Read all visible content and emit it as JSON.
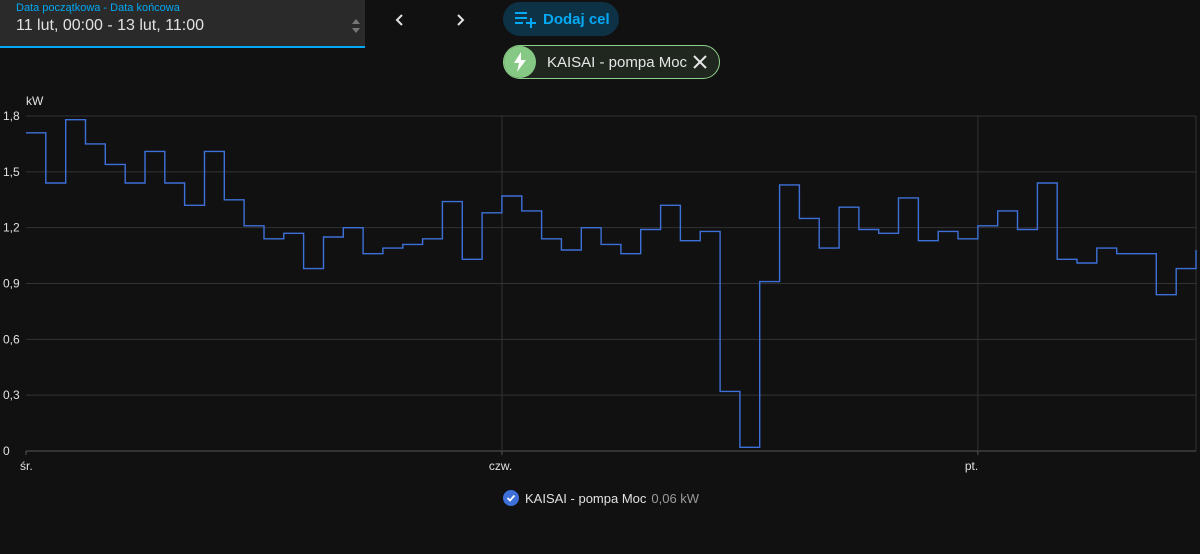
{
  "date_range": {
    "label": "Data początkowa - Data końcowa",
    "value": "11 lut, 00:00 - 13 lut, 11:00"
  },
  "nav": {
    "prev_icon": "chevron-left-icon",
    "next_icon": "chevron-right-icon"
  },
  "add_target": {
    "label": "Dodaj cel",
    "icon": "playlist-plus-icon"
  },
  "entity_chip": {
    "label": "KAISAI - pompa Moc",
    "icon": "flash-icon",
    "close_icon": "close-icon",
    "color": "#86c985"
  },
  "legend": {
    "name": "KAISAI - pompa Moc",
    "value": "0,06 kW",
    "color": "#3d71d9"
  },
  "chart_data": {
    "type": "line",
    "ylabel": "kW",
    "y_ticks": [
      "1,8",
      "1,5",
      "1,2",
      "0,9",
      "0,6",
      "0,3",
      "0"
    ],
    "y_tick_values": [
      1.8,
      1.5,
      1.2,
      0.9,
      0.6,
      0.3,
      0
    ],
    "ylim": [
      0,
      1.8
    ],
    "x_ticks": [
      "śr.",
      "czw.",
      "pt."
    ],
    "x_tick_hours": [
      0,
      24,
      48
    ],
    "xlim_hours": [
      0,
      59
    ],
    "grid": true,
    "step": true,
    "series": [
      {
        "name": "KAISAI - pompa Moc",
        "color": "#3d71d9",
        "values": [
          1.71,
          1.44,
          1.78,
          1.65,
          1.54,
          1.44,
          1.61,
          1.44,
          1.32,
          1.61,
          1.35,
          1.21,
          1.14,
          1.17,
          0.98,
          1.15,
          1.2,
          1.06,
          1.09,
          1.11,
          1.14,
          1.34,
          1.03,
          1.28,
          1.37,
          1.29,
          1.14,
          1.08,
          1.2,
          1.11,
          1.06,
          1.19,
          1.32,
          1.13,
          1.18,
          0.32,
          0.02,
          0.91,
          1.43,
          1.25,
          1.09,
          1.31,
          1.19,
          1.17,
          1.36,
          1.13,
          1.18,
          1.14,
          1.21,
          1.29,
          1.19,
          1.44,
          1.03,
          1.01,
          1.09,
          1.06,
          1.06,
          0.84,
          0.98,
          1.08
        ]
      }
    ]
  }
}
